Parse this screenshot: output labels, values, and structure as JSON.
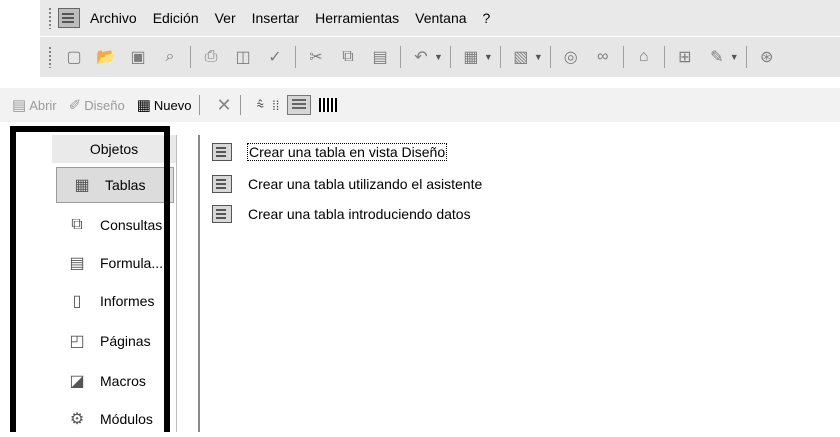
{
  "menubar": {
    "items": [
      {
        "label": "Archivo"
      },
      {
        "label": "Edición"
      },
      {
        "label": "Ver"
      },
      {
        "label": "Insertar"
      },
      {
        "label": "Herramientas"
      },
      {
        "label": "Ventana"
      },
      {
        "label": "?"
      }
    ]
  },
  "toolbar": {
    "icons": [
      "new-icon",
      "open-icon",
      "save-icon",
      "search-icon",
      "print-icon",
      "print-preview-icon",
      "spelling-icon",
      "cut-icon",
      "copy-icon",
      "paste-icon",
      "undo-icon",
      "office-links-icon",
      "analyze-icon",
      "code-icon",
      "properties-icon",
      "relationships-icon",
      "new-object-icon",
      "help-icon"
    ]
  },
  "dbbar": {
    "open_label": "Abrir",
    "design_label": "Diseño",
    "new_label": "Nuevo"
  },
  "sidebar": {
    "header": "Objetos",
    "items": [
      {
        "label": "Tablas",
        "icon": "table-icon",
        "selected": true
      },
      {
        "label": "Consultas",
        "icon": "query-icon"
      },
      {
        "label": "Formula...",
        "icon": "form-icon"
      },
      {
        "label": "Informes",
        "icon": "report-icon"
      },
      {
        "label": "Páginas",
        "icon": "page-icon"
      },
      {
        "label": "Macros",
        "icon": "macro-icon"
      },
      {
        "label": "Módulos",
        "icon": "module-icon"
      }
    ]
  },
  "main": {
    "items": [
      {
        "label": "Crear una tabla en vista Diseño"
      },
      {
        "label": "Crear una tabla utilizando el asistente"
      },
      {
        "label": "Crear una tabla introduciendo datos"
      }
    ]
  }
}
